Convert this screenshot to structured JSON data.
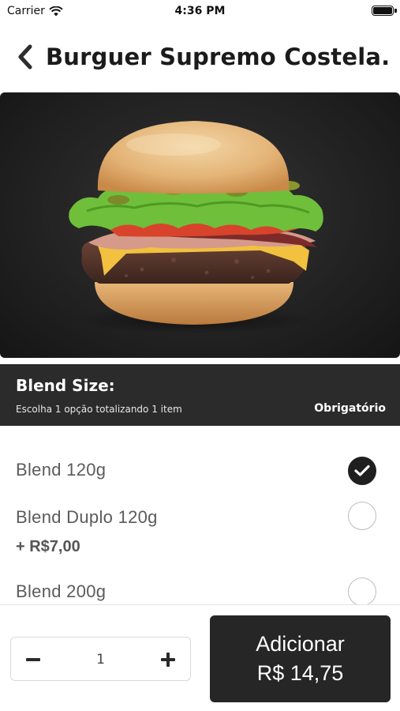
{
  "status_bar": {
    "carrier": "Carrier",
    "time": "4:36 PM"
  },
  "header": {
    "title": "Burguer Supremo Costela."
  },
  "hero": {
    "image_description": "burger-photo"
  },
  "section": {
    "title": "Blend Size:",
    "subtitle": "Escolha 1 opção totalizando 1 item",
    "badge": "Obrigatório"
  },
  "options": [
    {
      "label": "Blend 120g",
      "price": "",
      "selected": true
    },
    {
      "label": "Blend Duplo 120g",
      "price": "+ R$7,00",
      "selected": false
    },
    {
      "label": "Blend 200g",
      "price": "",
      "selected": false
    }
  ],
  "quantity": {
    "minus_icon": "minus-icon",
    "value": "1",
    "plus_icon": "plus-icon"
  },
  "add_button": {
    "label": "Adicionar",
    "price": "R$ 14,75"
  },
  "colors": {
    "dark": "#262626",
    "section_bg": "#2b2b2b",
    "option_text": "#5b5b5b"
  }
}
